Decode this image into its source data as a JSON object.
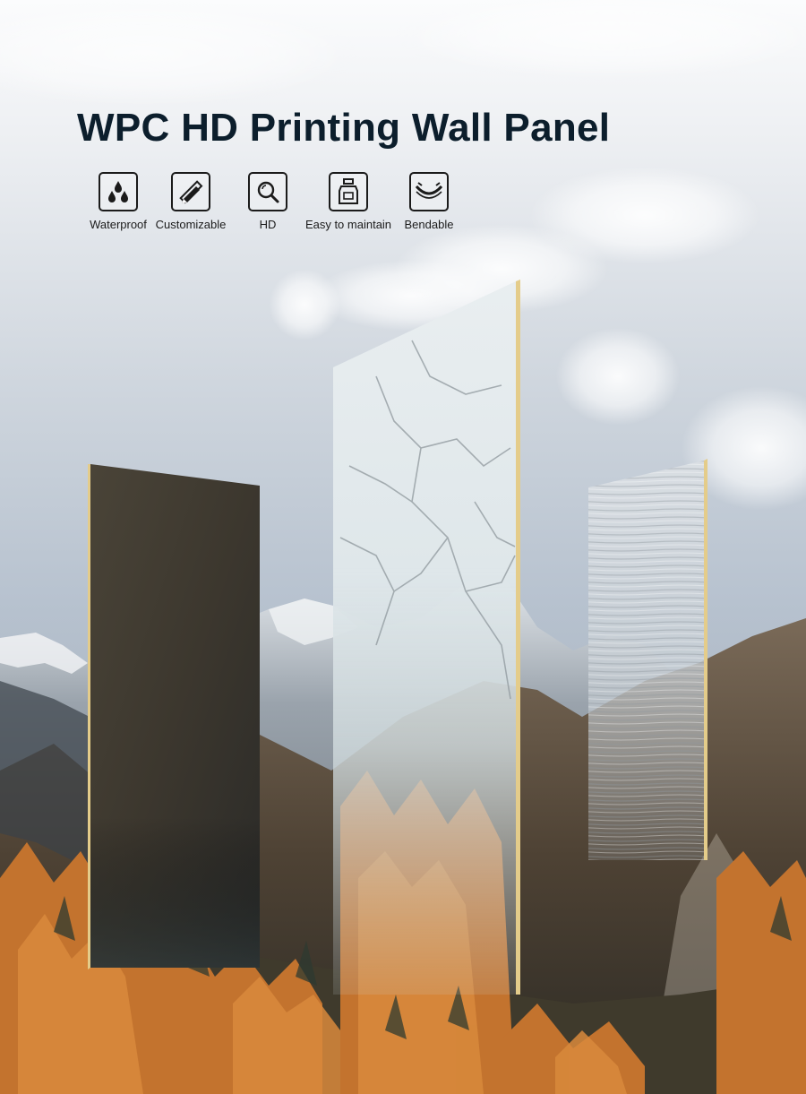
{
  "title": "WPC HD Printing Wall Panel",
  "features": [
    {
      "label": "Waterproof",
      "icon": "water-drops-icon"
    },
    {
      "label": "Customizable",
      "icon": "pencil-ruler-icon"
    },
    {
      "label": "HD",
      "icon": "magnifier-icon"
    },
    {
      "label": "Easy to maintain",
      "icon": "spray-bottle-icon"
    },
    {
      "label": "Bendable",
      "icon": "bending-panel-icon"
    }
  ],
  "panels": [
    {
      "name": "dark-concrete-panel",
      "finish": "dark stone"
    },
    {
      "name": "white-marble-panel",
      "finish": "white marble"
    },
    {
      "name": "striped-grey-panel",
      "finish": "grey wood grain"
    }
  ],
  "colors": {
    "title": "#0c1e2c",
    "panel_edge": "#e4cc8a",
    "sky": "#b7c2cf",
    "foliage": "#c3732e"
  }
}
